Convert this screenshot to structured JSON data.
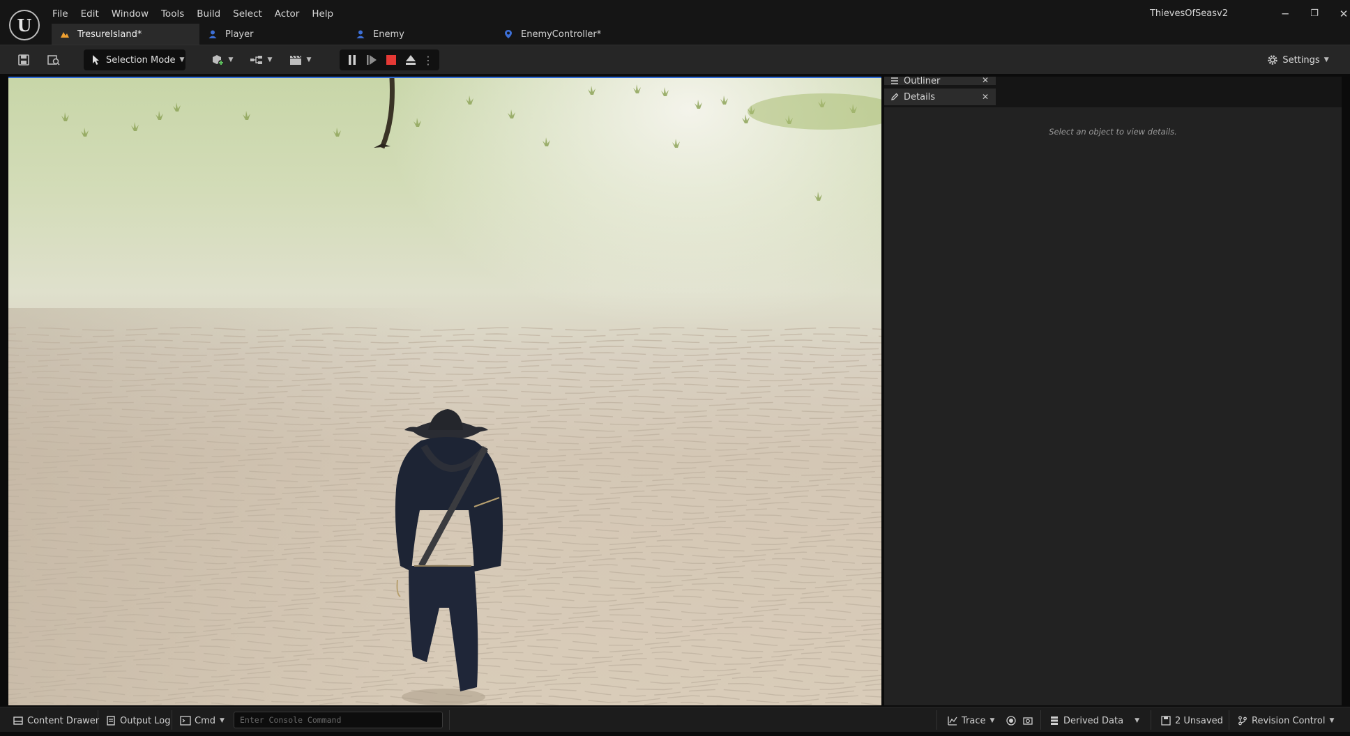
{
  "app": {
    "title": "ThievesOfSeasv2",
    "logo_text": "U"
  },
  "menu": [
    "File",
    "Edit",
    "Window",
    "Tools",
    "Build",
    "Select",
    "Actor",
    "Help"
  ],
  "window_controls": {
    "minimize": "─",
    "restore": "❐",
    "close": "✕"
  },
  "tabs": [
    {
      "label": "TresureIsland*",
      "icon": "level-icon",
      "active": true
    },
    {
      "label": "Player",
      "icon": "blueprint-pawn-icon",
      "active": false
    },
    {
      "label": "Enemy",
      "icon": "blueprint-pawn-icon",
      "active": false
    },
    {
      "label": "EnemyController*",
      "icon": "blueprint-controller-icon",
      "active": false
    }
  ],
  "toolbar": {
    "selection_mode_label": "Selection Mode",
    "settings_label": "Settings"
  },
  "panels": {
    "outliner_tab": "Outliner",
    "details_tab": "Details",
    "details_hint": "Select an object to view details."
  },
  "statusbar": {
    "content_drawer": "Content Drawer",
    "output_log": "Output Log",
    "cmd": "Cmd",
    "console_placeholder": "Enter Console Command",
    "trace": "Trace",
    "derived_data": "Derived Data",
    "unsaved": "2 Unsaved",
    "revision_control": "Revision Control"
  },
  "colors": {
    "accent_play_stop": "#e53935",
    "level_tab_icon": "#f0a030",
    "blueprint_icon": "#3d6fd6",
    "viewport_border": "#2f6ad6"
  }
}
